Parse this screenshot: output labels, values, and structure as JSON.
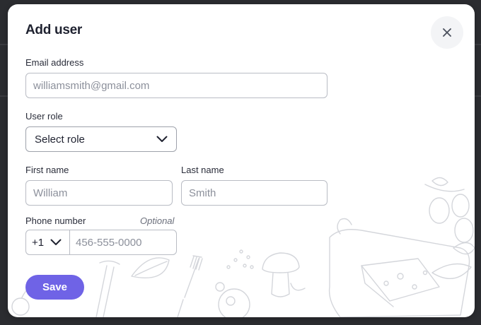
{
  "modal": {
    "title": "Add user",
    "close_icon": "close-icon"
  },
  "email": {
    "label": "Email address",
    "value": "",
    "placeholder": "williamsmith@gmail.com"
  },
  "role": {
    "label": "User role",
    "selected": "Select role",
    "icon": "chevron-down-icon"
  },
  "first_name": {
    "label": "First name",
    "value": "",
    "placeholder": "William"
  },
  "last_name": {
    "label": "Last name",
    "value": "",
    "placeholder": "Smith"
  },
  "phone": {
    "label": "Phone number",
    "optional_label": "Optional",
    "country_code": "+1",
    "value": "",
    "placeholder": "456-555-0000",
    "icon": "chevron-down-icon"
  },
  "actions": {
    "save_label": "Save"
  },
  "colors": {
    "primary": "#6f63e6",
    "backdrop": "#2b2c30",
    "text": "#1f2230",
    "border": "#b9bcc4",
    "placeholder": "#8c909b"
  }
}
